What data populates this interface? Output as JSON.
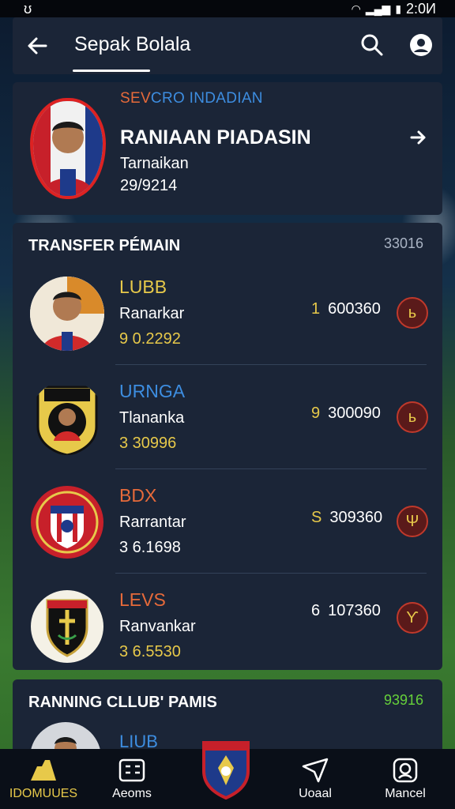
{
  "status_bar": {
    "left_icon": "bluetooth-icon",
    "time": "2:0И"
  },
  "header": {
    "title": "Sepak Bolala",
    "back_icon": "arrow-left-icon",
    "search_icon": "search-icon",
    "account_icon": "account-icon"
  },
  "featured": {
    "subtitle_part1": "SEV",
    "subtitle_part2": "CRO INDADIAN",
    "name": "RANIAAN PIADASIN",
    "meta": "Tarnaikan",
    "date": "29/9214"
  },
  "transfer": {
    "title": "TRANSFER PÉMAIN",
    "count": "33016",
    "rows": [
      {
        "club": "LUBB",
        "club_color": "#e7c94a",
        "status": "Ranarkar",
        "price": "9 0.2292",
        "fee_num": "1",
        "fee": "600360"
      },
      {
        "club": "URNGA",
        "club_color": "#3d8de0",
        "status": "Tlananka",
        "price": "3 30996",
        "fee_num": "9",
        "fee": "300090"
      },
      {
        "club": "BDX",
        "club_color": "#e66a3a",
        "status": "Rarrantar",
        "price": "3 6.1698",
        "fee_num": "S",
        "fee": "309360"
      },
      {
        "club": "LEVS",
        "club_color": "#e66a3a",
        "status": "Ranvankar",
        "price": "3 6.5530",
        "fee_num": "6",
        "fee": "107360"
      }
    ]
  },
  "ranking": {
    "title": "RANNING CLLUB' PAMIS",
    "count": "93916",
    "peek_club": "LIUB"
  },
  "bottom_nav": [
    {
      "label": "IDOMUUES",
      "icon": "home-icon"
    },
    {
      "label": "Aeoms",
      "icon": "matches-icon"
    },
    {
      "label": "Uoaal",
      "icon": "send-icon"
    },
    {
      "label": "Mancel",
      "icon": "profile-icon"
    }
  ]
}
